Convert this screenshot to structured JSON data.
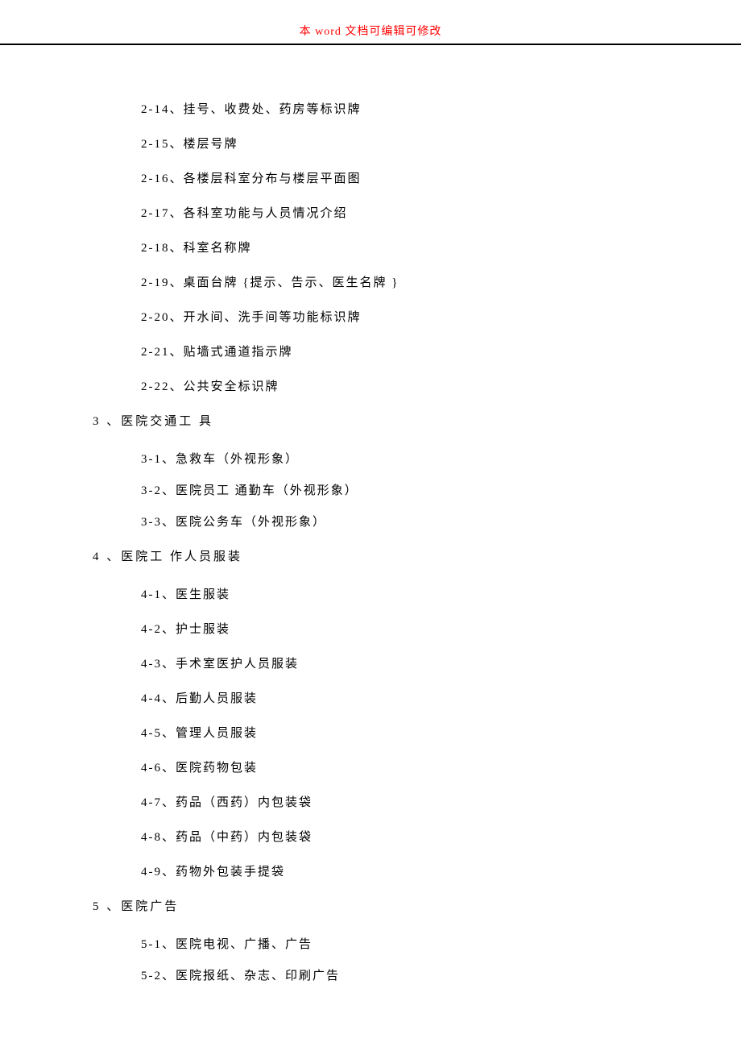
{
  "header": {
    "text": "本 word 文档可编辑可修改"
  },
  "sections": {
    "s2_items": [
      "2-14、挂号、收费处、药房等标识牌",
      "2-15、楼层号牌",
      "2-16、各楼层科室分布与楼层平面图",
      "2-17、各科室功能与人员情况介绍",
      "2-18、科室名称牌",
      "2-19、桌面台牌  {提示、告示、医生名牌  }",
      "2-20、开水间、洗手间等功能标识牌",
      "2-21、贴墙式通道指示牌",
      "2-22、公共安全标识牌"
    ],
    "s3_title": "3 、医院交通工 具",
    "s3_items": [
      "3-1、急救车（外视形象）",
      "3-2、医院员工 通勤车（外视形象）",
      "3-3、医院公务车（外视形象）"
    ],
    "s4_title": "4 、医院工 作人员服装",
    "s4_items": [
      "4-1、医生服装",
      "4-2、护士服装",
      "4-3、手术室医护人员服装",
      "4-4、后勤人员服装",
      "4-5、管理人员服装",
      "4-6、医院药物包装",
      "4-7、药品（西药）内包装袋",
      "4-8、药品（中药）内包装袋",
      "4-9、药物外包装手提袋"
    ],
    "s5_title": "5 、医院广告",
    "s5_items": [
      "5-1、医院电视、广播、广告",
      "5-2、医院报纸、杂志、印刷广告"
    ]
  }
}
